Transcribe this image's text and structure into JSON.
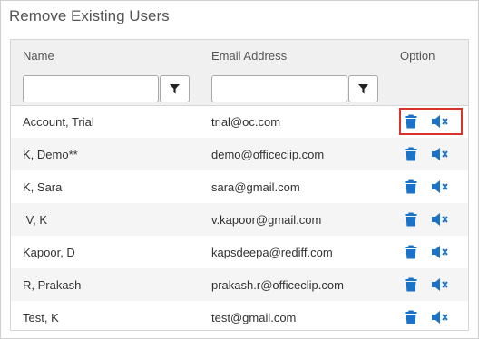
{
  "panel": {
    "title": "Remove Existing Users"
  },
  "grid": {
    "columns": {
      "name": "Name",
      "email": "Email Address",
      "option": "Option"
    },
    "filters": {
      "name_value": "",
      "email_value": ""
    },
    "icons": {
      "filter": "filter-icon",
      "delete": "trash-icon",
      "mute": "speaker-mute-icon"
    },
    "accent_color": "#1a73c8",
    "highlight_color": "#d9342b",
    "rows": [
      {
        "name": "Account, Trial",
        "email": "trial@oc.com"
      },
      {
        "name": "K, Demo**",
        "email": "demo@officeclip.com"
      },
      {
        "name": "K, Sara",
        "email": "sara@gmail.com"
      },
      {
        "name": " V, K",
        "email": "v.kapoor@gmail.com"
      },
      {
        "name": "Kapoor, D",
        "email": "kapsdeepa@rediff.com"
      },
      {
        "name": "R, Prakash",
        "email": "prakash.r@officeclip.com"
      },
      {
        "name": "Test, K",
        "email": "test@gmail.com"
      }
    ]
  }
}
